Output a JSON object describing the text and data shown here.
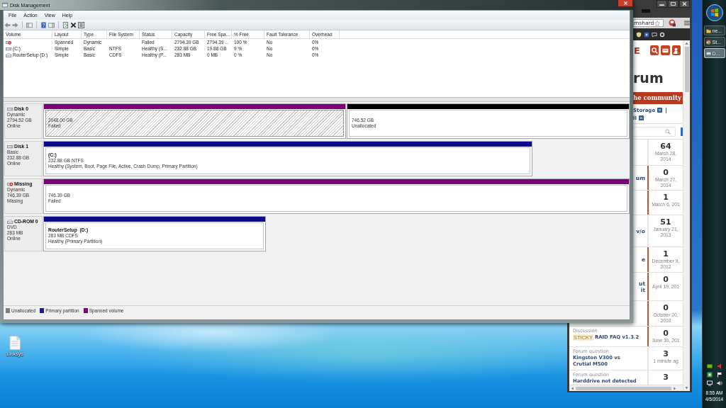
{
  "disk_management": {
    "title": "Disk Management",
    "menu": [
      "File",
      "Action",
      "View",
      "Help"
    ],
    "volume_list": {
      "columns": [
        "Volume",
        "Layout",
        "Type",
        "File System",
        "Status",
        "Capacity",
        "Free Spa...",
        "% Free",
        "Fault Tolerance",
        "Overhead"
      ],
      "rows": [
        {
          "kind": "failed",
          "layout": "Spanned",
          "type": "Dynamic",
          "status": "Failed",
          "capacity": "2794.39 GB",
          "free_space": "2794.39 ...",
          "percent_free": "100 %",
          "fault_tolerance": "No",
          "overhead": "0%"
        },
        {
          "kind": "drive",
          "volume": "(C:)",
          "layout": "Simple",
          "type": "Basic",
          "file_system": "NTFS",
          "status": "Healthy (S...",
          "capacity": "232.88 GB",
          "free_space": "19.88 GB",
          "percent_free": "9 %",
          "fault_tolerance": "No",
          "overhead": "0%"
        },
        {
          "kind": "cdrom",
          "volume": "RouterSetup (D:)",
          "layout": "Simple",
          "type": "Basic",
          "file_system": "CDFS",
          "status": "Healthy (P...",
          "capacity": "283 MB",
          "free_space": "0 MB",
          "percent_free": "0 %",
          "fault_tolerance": "No",
          "overhead": "0%"
        }
      ]
    },
    "disks": [
      {
        "kind": "disk",
        "name": "Disk 0",
        "type": "Dynamic",
        "size": "2794.52 GB",
        "status": "Online",
        "partitions": [
          {
            "kind": "spanned",
            "selected": true,
            "size": "2048.00 GB",
            "status": "Failed"
          },
          {
            "kind": "unallocated",
            "selected": false,
            "size": "746.52 GB",
            "status": "Unallocated"
          }
        ]
      },
      {
        "kind": "disk",
        "name": "Disk 1",
        "type": "Basic",
        "size": "232.88 GB",
        "status": "Online",
        "partitions": [
          {
            "kind": "primary",
            "selected": false,
            "name": "(C:)",
            "size": "232.88 GB NTFS",
            "status": "Healthy (System, Boot, Page File, Active, Crash Dump, Primary Partition)"
          }
        ]
      },
      {
        "kind": "missing",
        "name": "Missing",
        "type": "Dynamic",
        "size": "746.39 GB",
        "status": "Missing",
        "partitions": [
          {
            "kind": "spanned",
            "selected": false,
            "size": "746.39 GB",
            "status": "Failed"
          }
        ]
      },
      {
        "kind": "cdrom",
        "name": "CD-ROM 0",
        "type": "DVD",
        "size": "283 MB",
        "status": "Online",
        "partitions": [
          {
            "kind": "primary",
            "selected": false,
            "name": "RouterSetup  (D:)",
            "size": "283 MB CDFS",
            "status": "Healthy (Primary Partition)"
          }
        ]
      }
    ],
    "legend": [
      {
        "label": "Unallocated",
        "color": "#808080"
      },
      {
        "label": "Primary partition",
        "color": "#1c1c8c"
      },
      {
        "label": "Spanned volume",
        "color": "#800080"
      }
    ]
  },
  "browser": {
    "address": "mshard",
    "logo": "E",
    "heading": "rum",
    "banner": "he community",
    "filters": [
      {
        "label": "Storage"
      },
      {
        "label": "ll"
      }
    ],
    "topics": [
      {
        "kind": "cut",
        "count": "64",
        "date": [
          "March 28,",
          "2014"
        ],
        "marked": false
      },
      {
        "kind": "cut",
        "title": [
          "um"
        ],
        "count": "0",
        "date": [
          "March 27,",
          "2014"
        ],
        "marked": true
      },
      {
        "kind": "cut",
        "count": "1",
        "date": [
          "March 6, 201"
        ],
        "marked": true
      },
      {
        "kind": "cut",
        "title": [
          "v/o"
        ],
        "count": "51",
        "date": [
          "January 21,",
          "2013"
        ],
        "marked": false
      },
      {
        "kind": "cut",
        "title": [
          "e"
        ],
        "count": "1",
        "date": [
          "December 9,",
          "2012"
        ],
        "marked": true
      },
      {
        "kind": "cut",
        "title": [
          "ut",
          "it"
        ],
        "count": "0",
        "date": [
          "April 19, 201"
        ],
        "marked": true
      },
      {
        "kind": "cut",
        "count": "0",
        "date": [
          "October 20,",
          "2010"
        ],
        "marked": true
      },
      {
        "kind": "full",
        "category": "Discussion",
        "badge": "STICKY",
        "title": [
          "RAID FAQ v1.3.2"
        ],
        "count": "0",
        "date": [
          "June 30, 201"
        ],
        "marked": true
      },
      {
        "kind": "full",
        "category": "Forum question",
        "title": [
          "Kingston V300 vs",
          "Crutial M500"
        ],
        "count": "3",
        "date": [
          "1 minute ag"
        ],
        "marked": false
      },
      {
        "kind": "full",
        "category": "Forum question",
        "title": [
          "Harddrive not detected"
        ],
        "count": "3",
        "marked": false
      }
    ]
  },
  "desktop": {
    "icons": [
      {
        "label": "Linksys"
      }
    ]
  },
  "taskbar": {
    "buttons": [
      {
        "kind": "folder",
        "label": "ne...",
        "selected": false
      },
      {
        "kind": "browser",
        "label": "St...",
        "selected": false
      },
      {
        "kind": "disk",
        "label": "D...",
        "selected": true
      }
    ],
    "time": "8:55 AM",
    "date": "4/5/2014"
  }
}
